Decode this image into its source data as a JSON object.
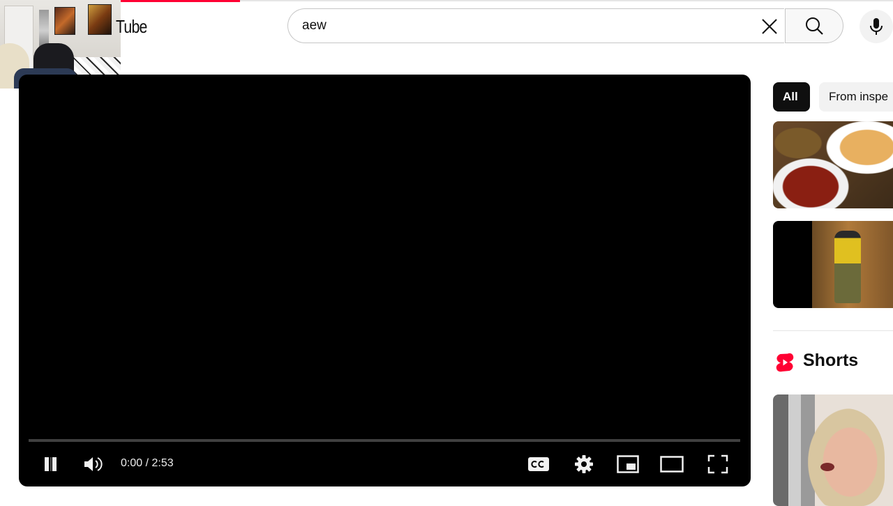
{
  "header": {
    "logo_text": "Tube",
    "search": {
      "value": "aew",
      "placeholder": "Search"
    }
  },
  "player": {
    "time_display": "0:00 / 2:53",
    "progress": 0
  },
  "sidebar": {
    "chips": [
      {
        "label": "All",
        "selected": true
      },
      {
        "label": "From inspe",
        "selected": false
      }
    ],
    "shorts_title": "Shorts"
  },
  "colors": {
    "accent": "#ff0033",
    "text": "#0f0f0f",
    "chip_selected_bg": "#0f0f0f",
    "chip_bg": "#f2f2f2"
  },
  "icons": [
    "youtube-logo",
    "close-icon",
    "search-icon",
    "mic-icon",
    "pause-icon",
    "volume-icon",
    "captions-icon",
    "settings-icon",
    "miniplayer-icon",
    "theater-icon",
    "fullscreen-icon",
    "shorts-icon"
  ]
}
